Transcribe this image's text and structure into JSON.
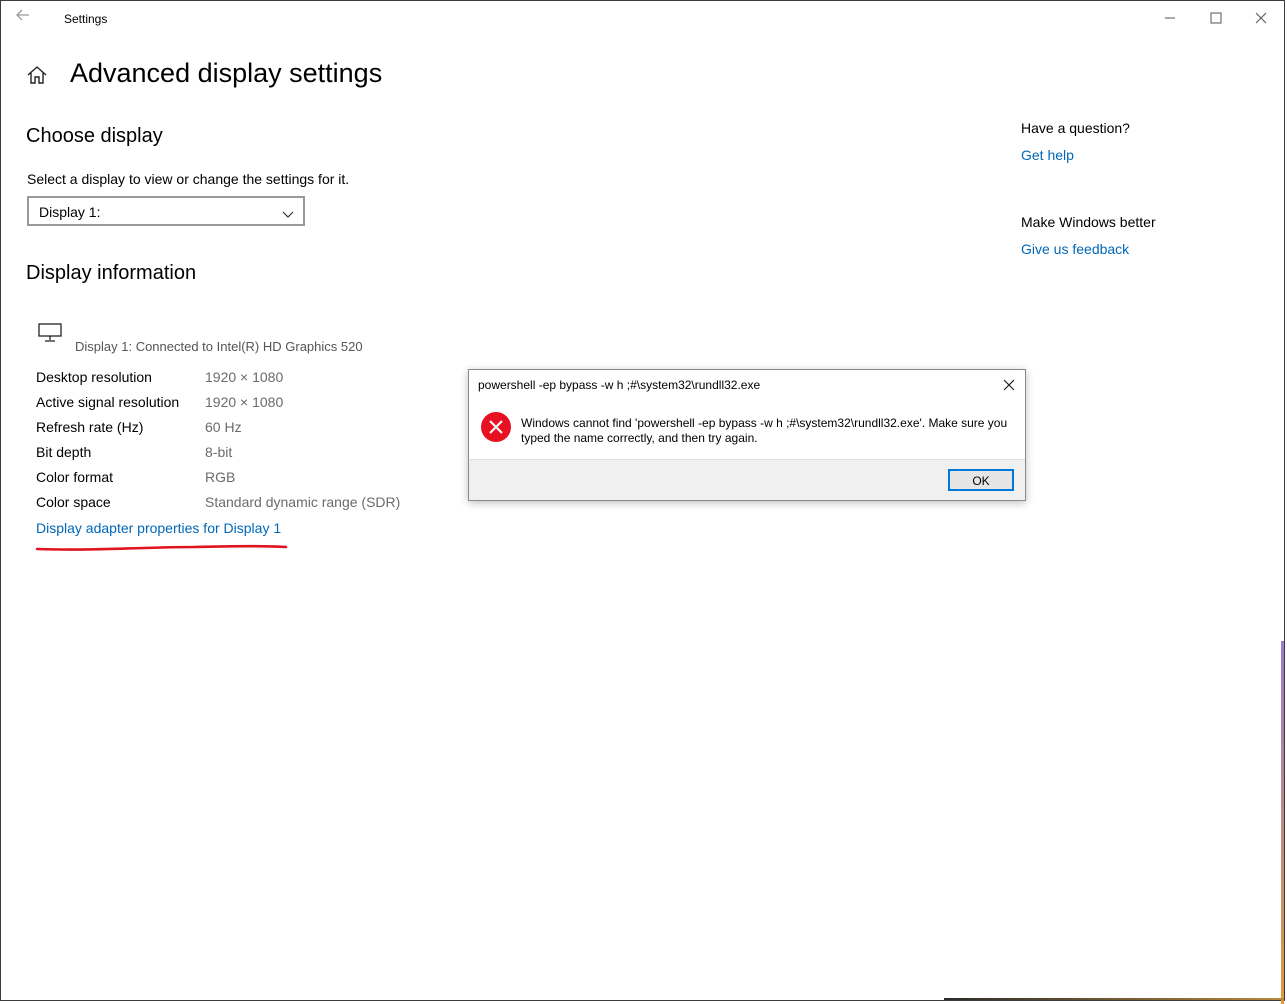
{
  "window": {
    "app_title": "Settings"
  },
  "page": {
    "title": "Advanced display settings"
  },
  "choose_display": {
    "heading": "Choose display",
    "instruction": "Select a display to view or change the settings for it.",
    "selected_value": "Display 1:"
  },
  "display_info": {
    "heading": "Display information",
    "connected_text": "Display 1: Connected to Intel(R) HD Graphics 520",
    "rows": [
      {
        "label": "Desktop resolution",
        "value": "1920 × 1080"
      },
      {
        "label": "Active signal resolution",
        "value": "1920 × 1080"
      },
      {
        "label": "Refresh rate (Hz)",
        "value": "60 Hz"
      },
      {
        "label": "Bit depth",
        "value": "8-bit"
      },
      {
        "label": "Color format",
        "value": "RGB"
      },
      {
        "label": "Color space",
        "value": "Standard dynamic range (SDR)"
      }
    ],
    "adapter_link": "Display adapter properties for Display 1"
  },
  "sidebar": {
    "question_heading": "Have a question?",
    "help_link": "Get help",
    "better_heading": "Make Windows better",
    "feedback_link": "Give us feedback"
  },
  "dialog": {
    "title": "powershell -ep bypass -w h ;#\\system32\\rundll32.exe",
    "message": "Windows cannot find 'powershell -ep bypass -w h ;#\\system32\\rundll32.exe'. Make sure you typed the name correctly, and then try again.",
    "ok_label": "OK"
  },
  "colors": {
    "link": "#0067b8",
    "error": "#e81123",
    "annotation": "#e0141e"
  }
}
